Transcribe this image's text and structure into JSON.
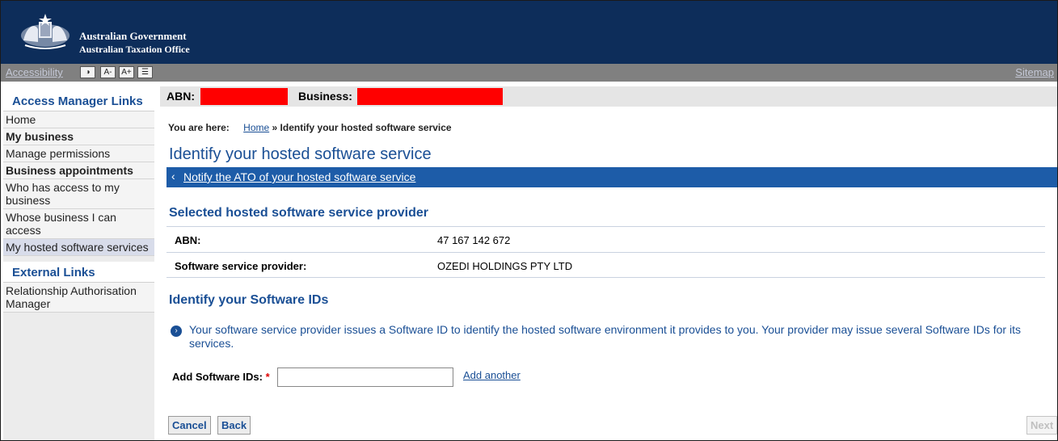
{
  "header": {
    "gov_line1": "Australian Government",
    "gov_line2": "Australian Taxation Office"
  },
  "accessibility_bar": {
    "accessibility_label": "Accessibility",
    "contrast_label": "◑",
    "font_decrease_label": "A-",
    "font_increase_label": "A+",
    "layout_label": "☰",
    "sitemap_label": "Sitemap"
  },
  "sidebar": {
    "access_heading": "Access Manager Links",
    "items": [
      {
        "label": "Home",
        "bold": false,
        "active": false
      },
      {
        "label": "My business",
        "bold": true,
        "active": false
      },
      {
        "label": "Manage permissions",
        "bold": false,
        "active": false
      },
      {
        "label": "Business appointments",
        "bold": true,
        "active": false
      },
      {
        "label": "Who has access to my business",
        "bold": false,
        "active": false
      },
      {
        "label": "Whose business I can access",
        "bold": false,
        "active": false
      },
      {
        "label": "My hosted software services",
        "bold": false,
        "active": true
      }
    ],
    "external_heading": "External Links",
    "external_items": [
      {
        "label": "Relationship Authorisation Manager"
      }
    ]
  },
  "abn_bar": {
    "abn_label": "ABN:",
    "business_label": "Business:"
  },
  "breadcrumb": {
    "prefix": "You are here:",
    "home": "Home",
    "separator": "»",
    "current": "Identify your hosted software service"
  },
  "page": {
    "title": "Identify your hosted software service",
    "notify_link": "Notify the ATO of your hosted software service",
    "provider_section_title": "Selected hosted software service provider",
    "provider_details": [
      {
        "label": "ABN:",
        "value": "47 167 142 672"
      },
      {
        "label": "Software service provider:",
        "value": "OZEDI HOLDINGS PTY LTD"
      }
    ],
    "software_ids_title": "Identify your Software IDs",
    "info_text": "Your software service provider issues a Software ID to identify the hosted software environment it provides to you. Your provider may issue several Software IDs for its services.",
    "add_label": "Add Software IDs:",
    "required_mark": "*",
    "software_id_value": "",
    "add_another": "Add another"
  },
  "buttons": {
    "cancel": "Cancel",
    "back": "Back",
    "next": "Next"
  },
  "colors": {
    "banner": "#0d2d5a",
    "brand_blue": "#1a4f95",
    "notify_bar": "#1d5ca8",
    "redaction": "#ff0000"
  }
}
